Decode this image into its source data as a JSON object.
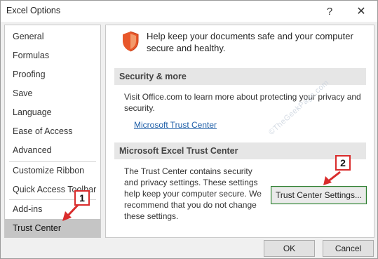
{
  "window": {
    "title": "Excel Options",
    "help_glyph": "?",
    "close_glyph": "✕"
  },
  "sidebar": {
    "items": [
      {
        "label": "General"
      },
      {
        "label": "Formulas"
      },
      {
        "label": "Proofing"
      },
      {
        "label": "Save"
      },
      {
        "label": "Language"
      },
      {
        "label": "Ease of Access"
      },
      {
        "label": "Advanced"
      },
      {
        "label": "Customize Ribbon"
      },
      {
        "label": "Quick Access Toolbar"
      },
      {
        "label": "Add-ins"
      },
      {
        "label": "Trust Center"
      }
    ],
    "selected": "Trust Center"
  },
  "main": {
    "intro": "Help keep your documents safe and your computer secure and healthy.",
    "security_header": "Security & more",
    "security_text": "Visit Office.com to learn more about protecting your privacy and security.",
    "security_link": "Microsoft Trust Center",
    "trust_header": "Microsoft Excel Trust Center",
    "trust_text": "The Trust Center contains security and privacy settings. These settings help keep your computer secure. We recommend that you do not change these settings.",
    "trust_button": "Trust Center Settings..."
  },
  "footer": {
    "ok": "OK",
    "cancel": "Cancel"
  },
  "annotations": {
    "step1": "1",
    "step2": "2",
    "watermark": "©TheGeekPage.com"
  },
  "colors": {
    "shield": "#e8572a",
    "annotation_red": "#d92c2c",
    "selected_bg": "#c5c5c5",
    "link": "#1f5fa8",
    "button_focus": "#2f7d32"
  },
  "icons": {
    "shield": "shield-icon",
    "help": "help-icon",
    "close": "close-icon"
  }
}
